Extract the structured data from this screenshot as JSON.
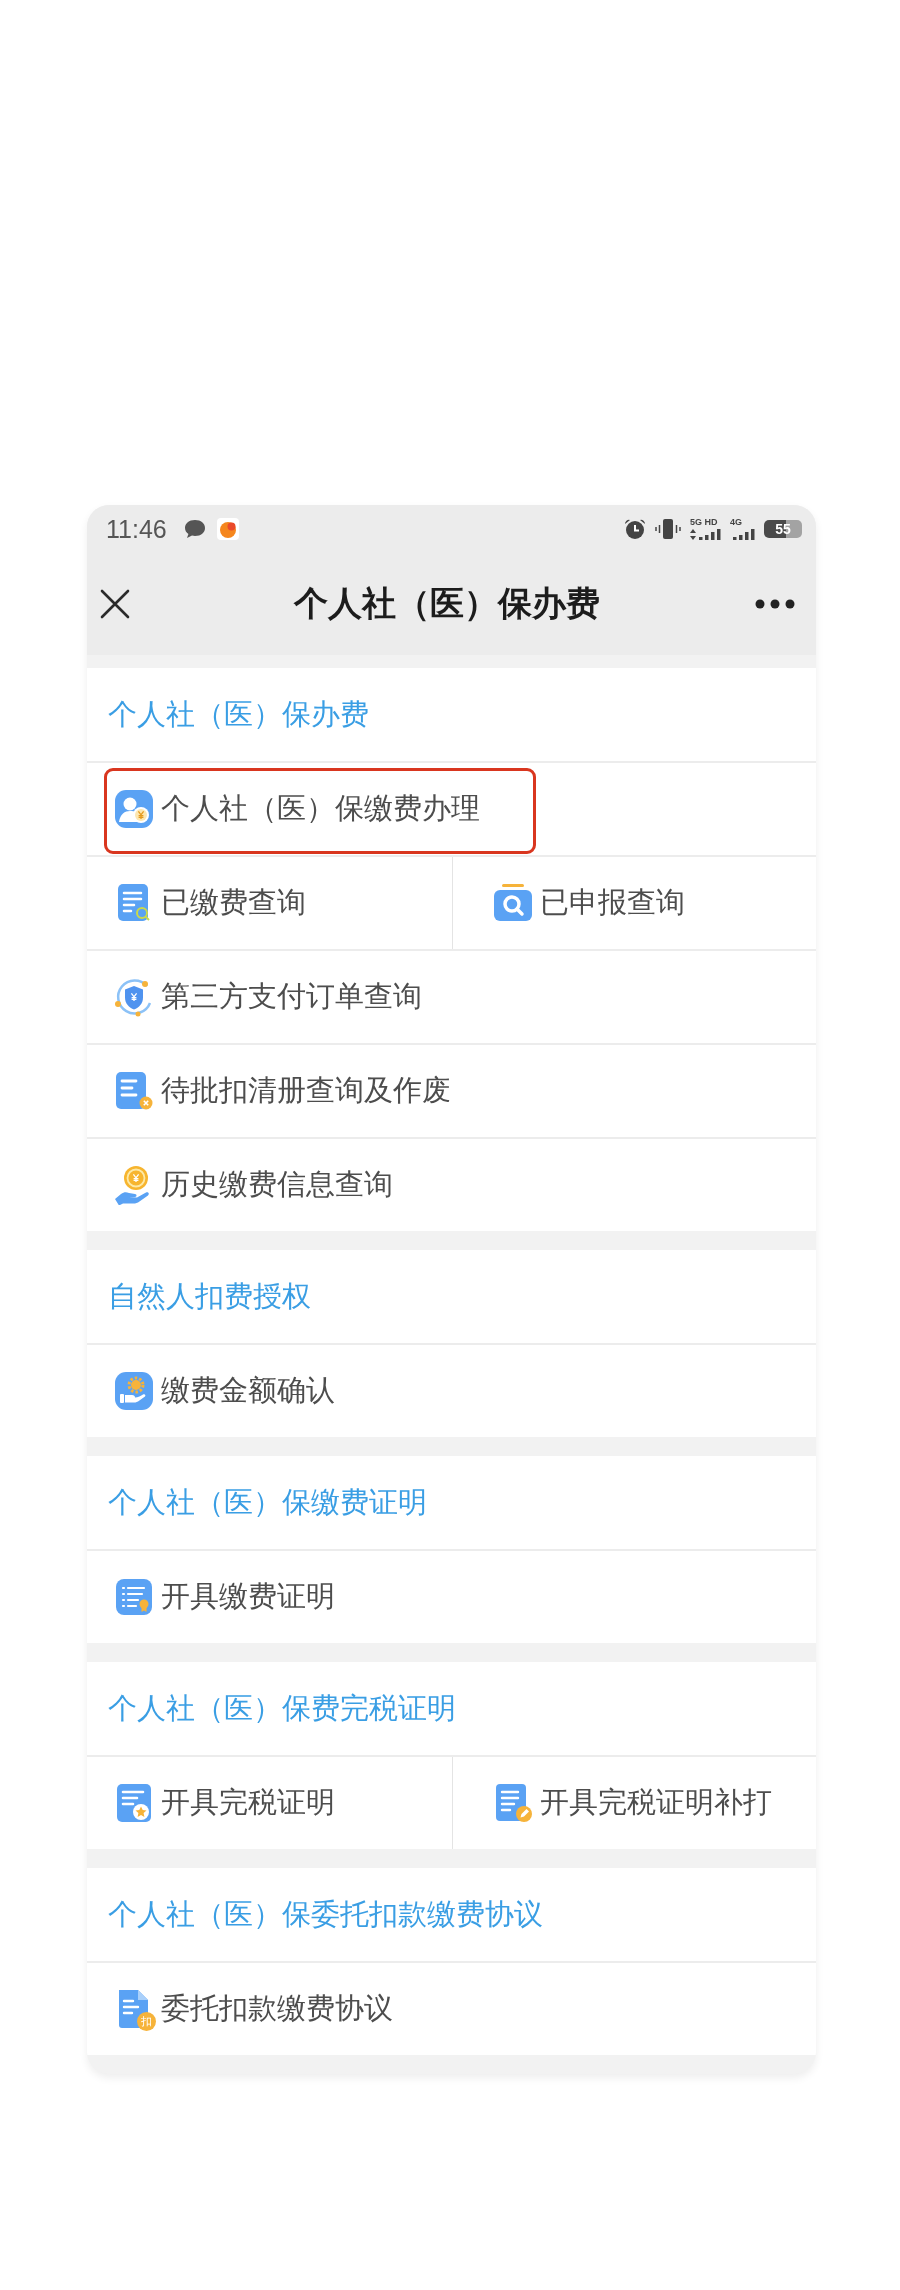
{
  "status_bar": {
    "time": "11:46",
    "networks": [
      {
        "label": "5G HD"
      },
      {
        "label": "4G"
      }
    ],
    "battery": "55"
  },
  "title_bar": {
    "title": "个人社（医）保办费"
  },
  "sections": [
    {
      "title": "个人社（医）保办费",
      "rows": [
        {
          "items": [
            {
              "label": "个人社（医）保缴费办理",
              "highlighted": true
            }
          ]
        },
        {
          "items": [
            {
              "label": "已缴费查询",
              "highlighted": false
            },
            {
              "label": "已申报查询",
              "highlighted": false
            }
          ]
        },
        {
          "items": [
            {
              "label": "第三方支付订单查询",
              "highlighted": false
            }
          ]
        },
        {
          "items": [
            {
              "label": "待批扣清册查询及作废",
              "highlighted": false
            }
          ]
        },
        {
          "items": [
            {
              "label": "历史缴费信息查询",
              "highlighted": false
            }
          ]
        }
      ]
    },
    {
      "title": "自然人扣费授权",
      "rows": [
        {
          "items": [
            {
              "label": "缴费金额确认",
              "highlighted": false
            }
          ]
        }
      ]
    },
    {
      "title": "个人社（医）保缴费证明",
      "rows": [
        {
          "items": [
            {
              "label": "开具缴费证明",
              "highlighted": false
            }
          ]
        }
      ]
    },
    {
      "title": "个人社（医）保费完税证明",
      "rows": [
        {
          "items": [
            {
              "label": "开具完税证明",
              "highlighted": false
            },
            {
              "label": "开具完税证明补打",
              "highlighted": false
            }
          ]
        }
      ]
    },
    {
      "title": "个人社（医）保委托扣款缴费协议",
      "rows": [
        {
          "items": [
            {
              "label": "委托扣款缴费协议",
              "highlighted": false,
              "badge": "扣"
            }
          ]
        }
      ]
    }
  ]
}
